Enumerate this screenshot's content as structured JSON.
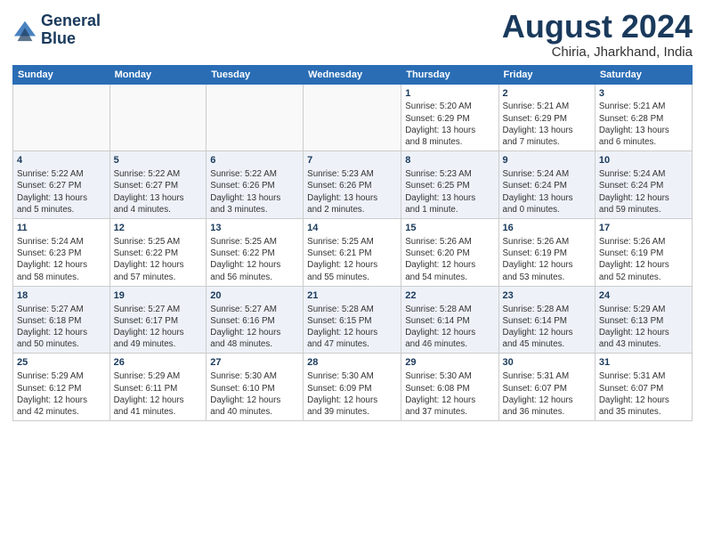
{
  "header": {
    "logo_line1": "General",
    "logo_line2": "Blue",
    "month_year": "August 2024",
    "location": "Chiria, Jharkhand, India"
  },
  "days_of_week": [
    "Sunday",
    "Monday",
    "Tuesday",
    "Wednesday",
    "Thursday",
    "Friday",
    "Saturday"
  ],
  "weeks": [
    [
      {
        "day": "",
        "info": ""
      },
      {
        "day": "",
        "info": ""
      },
      {
        "day": "",
        "info": ""
      },
      {
        "day": "",
        "info": ""
      },
      {
        "day": "1",
        "info": "Sunrise: 5:20 AM\nSunset: 6:29 PM\nDaylight: 13 hours\nand 8 minutes."
      },
      {
        "day": "2",
        "info": "Sunrise: 5:21 AM\nSunset: 6:29 PM\nDaylight: 13 hours\nand 7 minutes."
      },
      {
        "day": "3",
        "info": "Sunrise: 5:21 AM\nSunset: 6:28 PM\nDaylight: 13 hours\nand 6 minutes."
      }
    ],
    [
      {
        "day": "4",
        "info": "Sunrise: 5:22 AM\nSunset: 6:27 PM\nDaylight: 13 hours\nand 5 minutes."
      },
      {
        "day": "5",
        "info": "Sunrise: 5:22 AM\nSunset: 6:27 PM\nDaylight: 13 hours\nand 4 minutes."
      },
      {
        "day": "6",
        "info": "Sunrise: 5:22 AM\nSunset: 6:26 PM\nDaylight: 13 hours\nand 3 minutes."
      },
      {
        "day": "7",
        "info": "Sunrise: 5:23 AM\nSunset: 6:26 PM\nDaylight: 13 hours\nand 2 minutes."
      },
      {
        "day": "8",
        "info": "Sunrise: 5:23 AM\nSunset: 6:25 PM\nDaylight: 13 hours\nand 1 minute."
      },
      {
        "day": "9",
        "info": "Sunrise: 5:24 AM\nSunset: 6:24 PM\nDaylight: 13 hours\nand 0 minutes."
      },
      {
        "day": "10",
        "info": "Sunrise: 5:24 AM\nSunset: 6:24 PM\nDaylight: 12 hours\nand 59 minutes."
      }
    ],
    [
      {
        "day": "11",
        "info": "Sunrise: 5:24 AM\nSunset: 6:23 PM\nDaylight: 12 hours\nand 58 minutes."
      },
      {
        "day": "12",
        "info": "Sunrise: 5:25 AM\nSunset: 6:22 PM\nDaylight: 12 hours\nand 57 minutes."
      },
      {
        "day": "13",
        "info": "Sunrise: 5:25 AM\nSunset: 6:22 PM\nDaylight: 12 hours\nand 56 minutes."
      },
      {
        "day": "14",
        "info": "Sunrise: 5:25 AM\nSunset: 6:21 PM\nDaylight: 12 hours\nand 55 minutes."
      },
      {
        "day": "15",
        "info": "Sunrise: 5:26 AM\nSunset: 6:20 PM\nDaylight: 12 hours\nand 54 minutes."
      },
      {
        "day": "16",
        "info": "Sunrise: 5:26 AM\nSunset: 6:19 PM\nDaylight: 12 hours\nand 53 minutes."
      },
      {
        "day": "17",
        "info": "Sunrise: 5:26 AM\nSunset: 6:19 PM\nDaylight: 12 hours\nand 52 minutes."
      }
    ],
    [
      {
        "day": "18",
        "info": "Sunrise: 5:27 AM\nSunset: 6:18 PM\nDaylight: 12 hours\nand 50 minutes."
      },
      {
        "day": "19",
        "info": "Sunrise: 5:27 AM\nSunset: 6:17 PM\nDaylight: 12 hours\nand 49 minutes."
      },
      {
        "day": "20",
        "info": "Sunrise: 5:27 AM\nSunset: 6:16 PM\nDaylight: 12 hours\nand 48 minutes."
      },
      {
        "day": "21",
        "info": "Sunrise: 5:28 AM\nSunset: 6:15 PM\nDaylight: 12 hours\nand 47 minutes."
      },
      {
        "day": "22",
        "info": "Sunrise: 5:28 AM\nSunset: 6:14 PM\nDaylight: 12 hours\nand 46 minutes."
      },
      {
        "day": "23",
        "info": "Sunrise: 5:28 AM\nSunset: 6:14 PM\nDaylight: 12 hours\nand 45 minutes."
      },
      {
        "day": "24",
        "info": "Sunrise: 5:29 AM\nSunset: 6:13 PM\nDaylight: 12 hours\nand 43 minutes."
      }
    ],
    [
      {
        "day": "25",
        "info": "Sunrise: 5:29 AM\nSunset: 6:12 PM\nDaylight: 12 hours\nand 42 minutes."
      },
      {
        "day": "26",
        "info": "Sunrise: 5:29 AM\nSunset: 6:11 PM\nDaylight: 12 hours\nand 41 minutes."
      },
      {
        "day": "27",
        "info": "Sunrise: 5:30 AM\nSunset: 6:10 PM\nDaylight: 12 hours\nand 40 minutes."
      },
      {
        "day": "28",
        "info": "Sunrise: 5:30 AM\nSunset: 6:09 PM\nDaylight: 12 hours\nand 39 minutes."
      },
      {
        "day": "29",
        "info": "Sunrise: 5:30 AM\nSunset: 6:08 PM\nDaylight: 12 hours\nand 37 minutes."
      },
      {
        "day": "30",
        "info": "Sunrise: 5:31 AM\nSunset: 6:07 PM\nDaylight: 12 hours\nand 36 minutes."
      },
      {
        "day": "31",
        "info": "Sunrise: 5:31 AM\nSunset: 6:07 PM\nDaylight: 12 hours\nand 35 minutes."
      }
    ]
  ]
}
